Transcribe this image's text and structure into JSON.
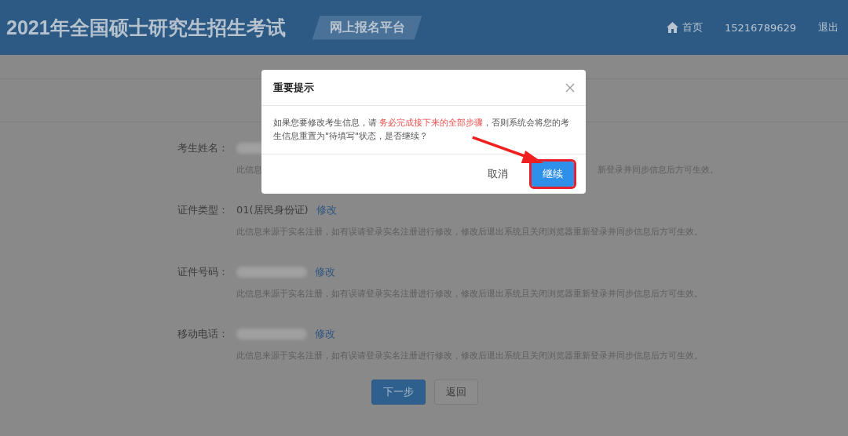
{
  "header": {
    "title": "2021年全国硕士研究生招生考试",
    "platform": "网上报名平台",
    "nav": [
      {
        "kind": "home",
        "label": "首页"
      },
      {
        "kind": "text",
        "label": "15216789629"
      },
      {
        "kind": "text",
        "label": "退出"
      }
    ]
  },
  "fields": [
    {
      "label": "考生姓名：",
      "value_blurred": true,
      "note_parts": [
        "此信息",
        "新登录并同步信息后方可生效。"
      ]
    },
    {
      "label": "证件类型：",
      "value": "01(居民身份证)",
      "link": "修改",
      "note_parts": [
        "此信息来源于实名注册，如有误请登录实名注册进行修改，修改后退出系统且关闭浏览器重新登录并同步信息后方可生效。"
      ]
    },
    {
      "label": "证件号码：",
      "value_blurred": true,
      "link": "修改",
      "note_parts": [
        "此信息来源于实名注册，如有误请登录实名注册进行修改，修改后退出系统且关闭浏览器重新登录并同步信息后方可生效。"
      ]
    },
    {
      "label": "移动电话：",
      "value_blurred": true,
      "link": "修改",
      "note_parts": [
        "此信息来源于实名注册，如有误请登录实名注册进行修改，修改后退出系统且关闭浏览器重新登录并同步信息后方可生效。"
      ]
    }
  ],
  "actions": [
    {
      "kind": "primary",
      "label": "下一步"
    },
    {
      "kind": "default",
      "label": "返回"
    }
  ],
  "dialog": {
    "title": "重要提示",
    "message_parts": [
      {
        "text": "如果您要修改考生信息，请 ",
        "highlight": false
      },
      {
        "text": "务必完成接下来的全部步骤",
        "highlight": true
      },
      {
        "text": "，否则系统会将您的考生信息重置为\"待填写\"状态，是否继续？",
        "highlight": false
      }
    ],
    "buttons": [
      {
        "kind": "cancel",
        "label": "取消",
        "highlighted": false
      },
      {
        "kind": "confirm",
        "label": "继续",
        "highlighted": true
      }
    ]
  }
}
